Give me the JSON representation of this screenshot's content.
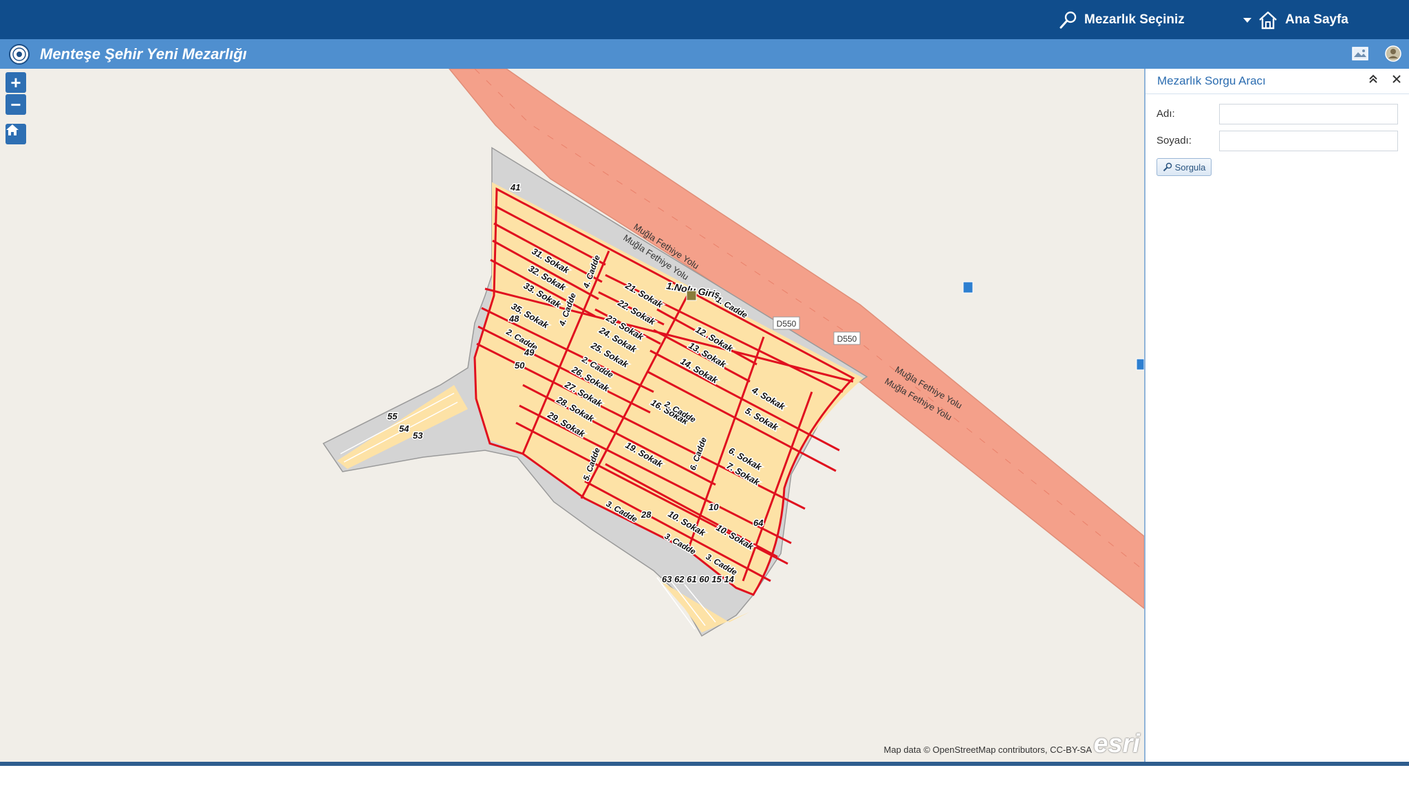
{
  "topbar": {
    "cemetery_select_label": "Mezarlık Seçiniz",
    "home_label": "Ana Sayfa"
  },
  "app": {
    "title": "Menteşe Şehir Yeni Mezarlığı"
  },
  "map": {
    "controls": {
      "zoom_in": "+",
      "zoom_out": "−"
    },
    "road_labels": [
      "Muğla Fethiye Yolu",
      "Muğla Fethiye Yolu",
      "Muğla Fethiye Yolu",
      "Muğla Fethiye Yolu"
    ],
    "road_shields": [
      "D550",
      "D550"
    ],
    "entrance_label": "1.Nolu Giriş",
    "street_labels": [
      "31. Sokak",
      "32. Sokak",
      "33. Sokak",
      "35. Sokak",
      "21. Sokak",
      "22. Sokak",
      "23. Sokak",
      "24. Sokak",
      "25. Sokak",
      "26. Sokak",
      "27. Sokak",
      "28. Sokak",
      "29. Sokak",
      "12. Sokak",
      "13. Sokak",
      "14. Sokak",
      "16. Sokak",
      "19. Sokak",
      "4. Sokak",
      "5. Sokak",
      "6. Sokak",
      "7. Sokak",
      "10. Sokak",
      "10. Sokak"
    ],
    "avenue_labels": [
      "1. Cadde",
      "2. Cadde",
      "2. Cadde",
      "2. Cadde",
      "3. Cadde",
      "3. Cadde",
      "3. Cadde",
      "4. Cadde",
      "4. Cadde",
      "5. Cadde",
      "6. Cadde"
    ],
    "parcel_numbers": [
      "41",
      "48",
      "49",
      "50",
      "55",
      "54",
      "53",
      "28",
      "10",
      "64",
      "63 62 61 60 15 14"
    ],
    "attribution": "Map data © OpenStreetMap contributors, CC-BY-SA",
    "logo_text": "esri"
  },
  "query_panel": {
    "title": "Mezarlık Sorgu Aracı",
    "first_name_label": "Adı:",
    "last_name_label": "Soyadı:",
    "first_name_value": "",
    "last_name_value": "",
    "search_button_label": "Sorgula"
  },
  "colors": {
    "topbar": "#104d8c",
    "titlebar": "#4f8fcf",
    "map_background": "#f1eee8",
    "road": "#f4a08a",
    "parcel_fill": "#fde2a6",
    "boundary": "#e0101f",
    "cemetery_ground": "#d4d4d4"
  }
}
